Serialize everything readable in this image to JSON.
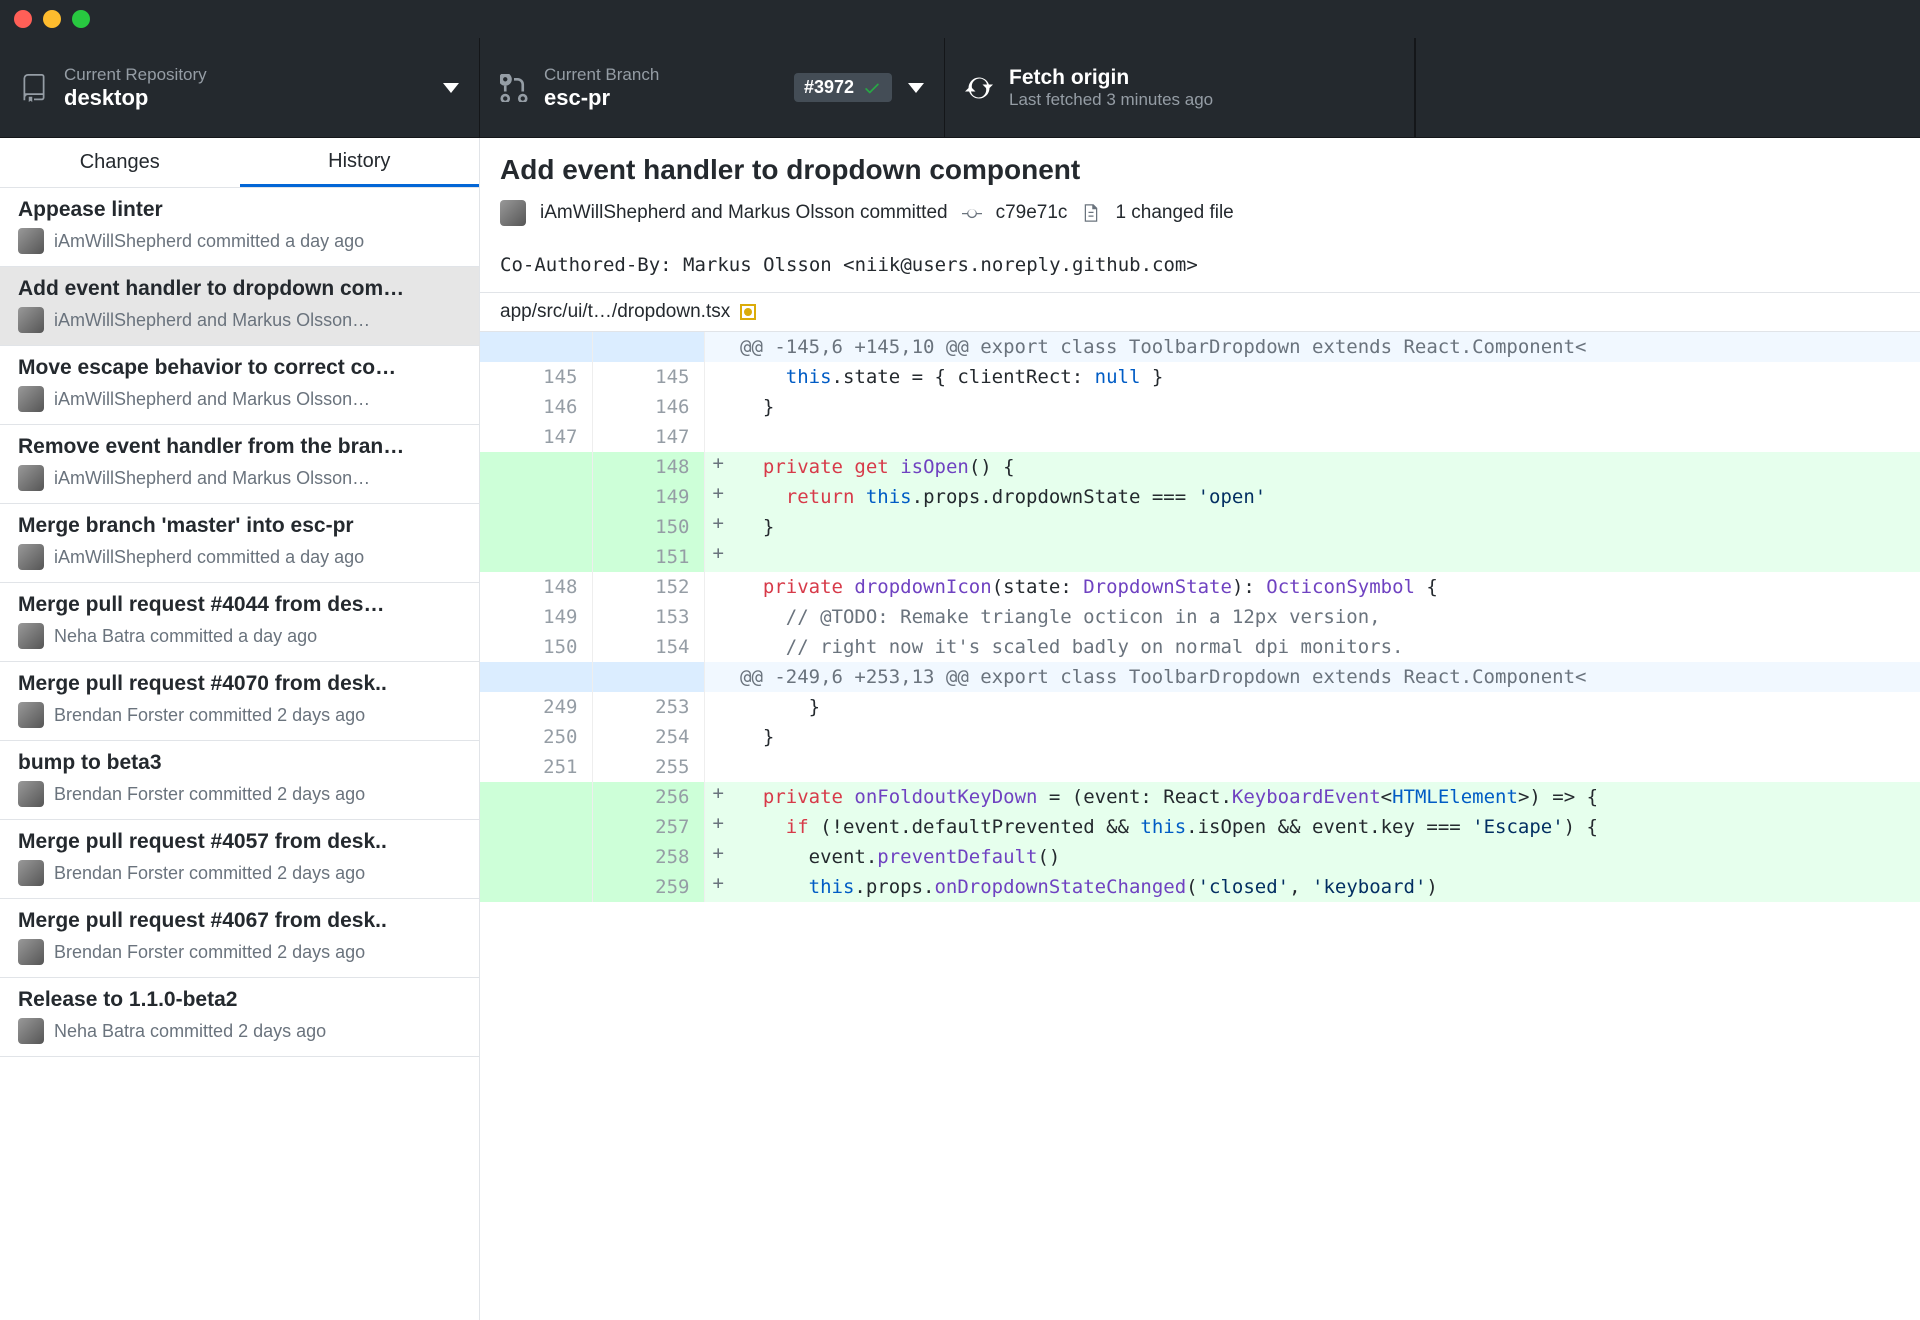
{
  "toolbar": {
    "repo_label": "Current Repository",
    "repo_value": "desktop",
    "branch_label": "Current Branch",
    "branch_value": "esc-pr",
    "pr_number": "#3972",
    "fetch_label": "Fetch origin",
    "fetch_sub": "Last fetched 3 minutes ago"
  },
  "tabs": {
    "changes": "Changes",
    "history": "History"
  },
  "commits": [
    {
      "title": "Appease linter",
      "byline": "iAmWillShepherd committed a day ago",
      "selected": false
    },
    {
      "title": "Add event handler to dropdown com…",
      "byline": "iAmWillShepherd and Markus Olsson…",
      "selected": true
    },
    {
      "title": "Move escape behavior to correct co…",
      "byline": "iAmWillShepherd and Markus Olsson…",
      "selected": false
    },
    {
      "title": "Remove event handler from the bran…",
      "byline": "iAmWillShepherd and Markus Olsson…",
      "selected": false
    },
    {
      "title": "Merge branch 'master' into esc-pr",
      "byline": "iAmWillShepherd committed a day ago",
      "selected": false
    },
    {
      "title": "Merge pull request #4044 from des…",
      "byline": "Neha Batra committed a day ago",
      "selected": false
    },
    {
      "title": "Merge pull request #4070 from desk..",
      "byline": "Brendan Forster committed 2 days ago",
      "selected": false
    },
    {
      "title": "bump to beta3",
      "byline": "Brendan Forster committed 2 days ago",
      "selected": false
    },
    {
      "title": "Merge pull request #4057 from desk..",
      "byline": "Brendan Forster committed 2 days ago",
      "selected": false
    },
    {
      "title": "Merge pull request #4067 from desk..",
      "byline": "Brendan Forster committed 2 days ago",
      "selected": false
    },
    {
      "title": "Release to 1.1.0-beta2",
      "byline": "Neha Batra committed 2 days ago",
      "selected": false
    }
  ],
  "detail": {
    "title": "Add event handler to dropdown component",
    "authors": "iAmWillShepherd and Markus Olsson committed",
    "sha": "c79e71c",
    "changed_files": "1 changed file",
    "coauthor": "Co-Authored-By: Markus Olsson <niik@users.noreply.github.com>",
    "file_path": "app/src/ui/t…/dropdown.tsx"
  },
  "diff": [
    {
      "type": "hunk",
      "old": "",
      "new": "",
      "sign": "",
      "html": "@@ -145,6 +145,10 @@ export class ToolbarDropdown extends React.Component&lt;"
    },
    {
      "type": "ctx",
      "old": "145",
      "new": "145",
      "sign": "",
      "html": "    <span class='this'>this</span>.state = { clientRect: <span class='num-null'>null</span> }"
    },
    {
      "type": "ctx",
      "old": "146",
      "new": "146",
      "sign": "",
      "html": "  }"
    },
    {
      "type": "ctx",
      "old": "147",
      "new": "147",
      "sign": "",
      "html": ""
    },
    {
      "type": "add",
      "old": "",
      "new": "148",
      "sign": "+",
      "html": "  <span class='kw'>private</span> <span class='kw'>get</span> <span class='fn'>isOpen</span>() {"
    },
    {
      "type": "add",
      "old": "",
      "new": "149",
      "sign": "+",
      "html": "    <span class='kw'>return</span> <span class='this'>this</span>.props.dropdownState === <span class='str'>'open'</span>"
    },
    {
      "type": "add",
      "old": "",
      "new": "150",
      "sign": "+",
      "html": "  }"
    },
    {
      "type": "add",
      "old": "",
      "new": "151",
      "sign": "+",
      "html": ""
    },
    {
      "type": "ctx",
      "old": "148",
      "new": "152",
      "sign": "",
      "html": "  <span class='kw'>private</span> <span class='fn'>dropdownIcon</span>(state: <span class='typeRef'>DropdownState</span>): <span class='typeRef'>OcticonSymbol</span> {"
    },
    {
      "type": "ctx",
      "old": "149",
      "new": "153",
      "sign": "",
      "html": "    <span class='cmt'>// @TODO: Remake triangle octicon in a 12px version,</span>"
    },
    {
      "type": "ctx",
      "old": "150",
      "new": "154",
      "sign": "",
      "html": "    <span class='cmt'>// right now it's scaled badly on normal dpi monitors.</span>"
    },
    {
      "type": "hunk",
      "old": "",
      "new": "",
      "sign": "",
      "html": "@@ -249,6 +253,13 @@ export class ToolbarDropdown extends React.Component&lt;"
    },
    {
      "type": "ctx",
      "old": "249",
      "new": "253",
      "sign": "",
      "html": "      }"
    },
    {
      "type": "ctx",
      "old": "250",
      "new": "254",
      "sign": "",
      "html": "  }"
    },
    {
      "type": "ctx",
      "old": "251",
      "new": "255",
      "sign": "",
      "html": ""
    },
    {
      "type": "add",
      "old": "",
      "new": "256",
      "sign": "+",
      "html": "  <span class='kw'>private</span> <span class='fn'>onFoldoutKeyDown</span> = (event: React.<span class='typeRef'>KeyboardEvent</span>&lt;<span class='type'>HTMLElement</span>&gt;) =&gt; {"
    },
    {
      "type": "add",
      "old": "",
      "new": "257",
      "sign": "+",
      "html": "    <span class='kw'>if</span> (!event.defaultPrevented &amp;&amp; <span class='this'>this</span>.isOpen &amp;&amp; event.key === <span class='str'>'Escape'</span>) {"
    },
    {
      "type": "add",
      "old": "",
      "new": "258",
      "sign": "+",
      "html": "      event.<span class='fn'>preventDefault</span>()"
    },
    {
      "type": "add",
      "old": "",
      "new": "259",
      "sign": "+",
      "html": "      <span class='this'>this</span>.props.<span class='fn'>onDropdownStateChanged</span>(<span class='str'>'closed'</span>, <span class='str'>'keyboard'</span>)"
    }
  ]
}
